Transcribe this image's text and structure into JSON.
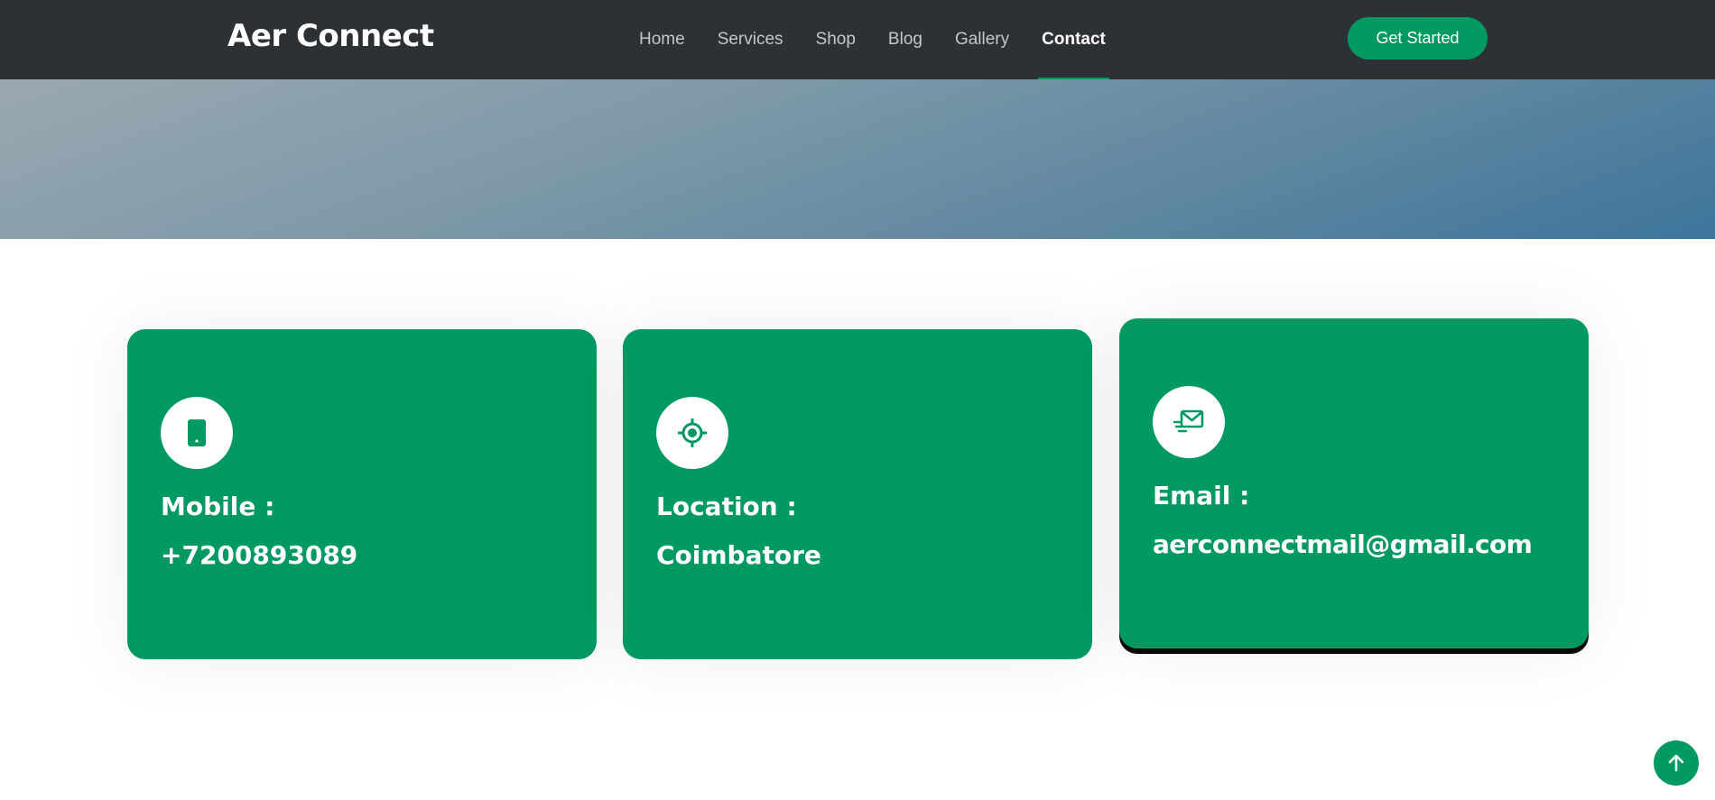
{
  "brand": "Aer Connect",
  "nav": {
    "items": [
      "Home",
      "Services",
      "Shop",
      "Blog",
      "Gallery",
      "Contact"
    ],
    "active": "Contact"
  },
  "cta_label": "Get Started",
  "colors": {
    "accent": "#009961",
    "navbar": "#2d3135"
  },
  "cards": [
    {
      "icon": "phone-icon",
      "label": "Mobile :",
      "value": "+7200893089"
    },
    {
      "icon": "crosshair-icon",
      "label": "Location :",
      "value": "Coimbatore"
    },
    {
      "icon": "mail-icon",
      "label": "Email :",
      "value": "aerconnectmail@gmail.com"
    }
  ],
  "scroll_top_icon": "arrow-up-icon"
}
